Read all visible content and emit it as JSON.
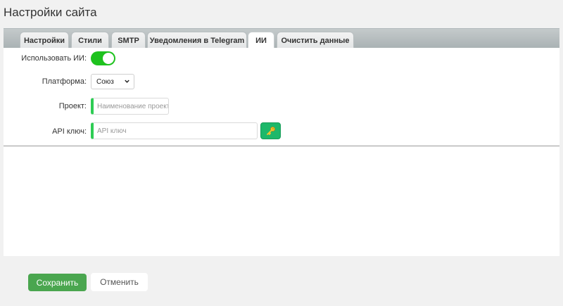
{
  "page": {
    "title": "Настройки сайта"
  },
  "tabs": [
    {
      "label": "Настройки",
      "active": false
    },
    {
      "label": "Стили",
      "active": false
    },
    {
      "label": "SMTP",
      "active": false
    },
    {
      "label": "Уведомления в Telegram",
      "active": false
    },
    {
      "label": "ИИ",
      "active": true
    },
    {
      "label": "Очистить данные",
      "active": false
    }
  ],
  "form": {
    "use_ai": {
      "label": "Использовать ИИ:",
      "enabled": true
    },
    "platform": {
      "label": "Платформа:",
      "value": "Союз"
    },
    "project": {
      "label": "Проект:",
      "placeholder": "Наименование проекта",
      "value": ""
    },
    "api_key": {
      "label": "API ключ:",
      "placeholder": "API ключ",
      "value": "",
      "button_icon": "key-icon"
    }
  },
  "actions": {
    "save_label": "Сохранить",
    "cancel_label": "Отменить"
  },
  "colors": {
    "accent_green": "#2ecc54",
    "toggle_on": "#1ec21e",
    "key_button": "#1db86a",
    "save_button": "#4aa64f"
  }
}
